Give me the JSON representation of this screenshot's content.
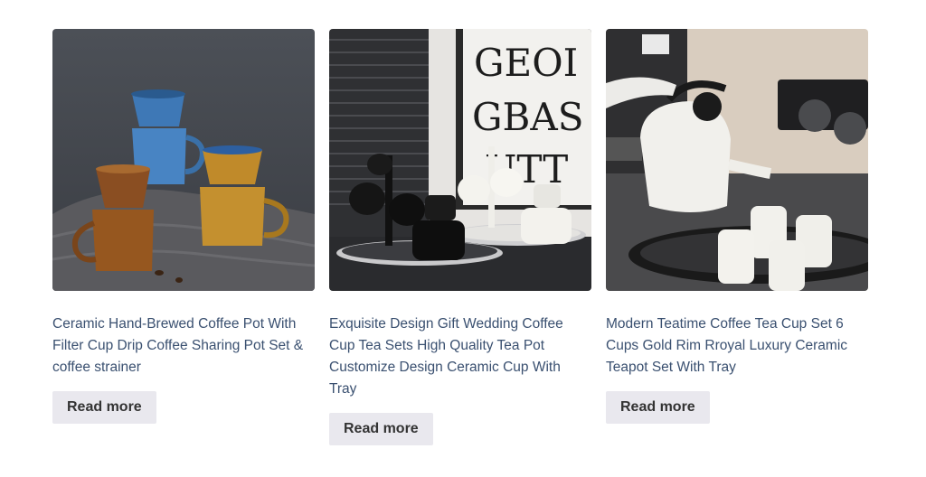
{
  "products": [
    {
      "title": "Ceramic Hand-Brewed Coffee Pot With Filter Cup Drip Coffee Sharing Pot Set & coffee strainer",
      "button": "Read more",
      "image": "product-photo"
    },
    {
      "title": "Exquisite Design Gift Wedding Coffee Cup Tea Sets High Quality Tea Pot Customize Design Ceramic Cup With Tray",
      "button": "Read more",
      "image": "product-photo"
    },
    {
      "title": "Modern Teatime Coffee Tea Cup Set 6 Cups Gold Rim Rroyal Luxury Ceramic Teapot Set With Tray",
      "button": "Read more",
      "image": "product-photo"
    }
  ],
  "colors": {
    "title_text": "#3a5070",
    "button_bg": "#e9e8ee",
    "button_text": "#333333"
  },
  "image_lettering": [
    "GEOI",
    "GBAS",
    "UTT"
  ]
}
